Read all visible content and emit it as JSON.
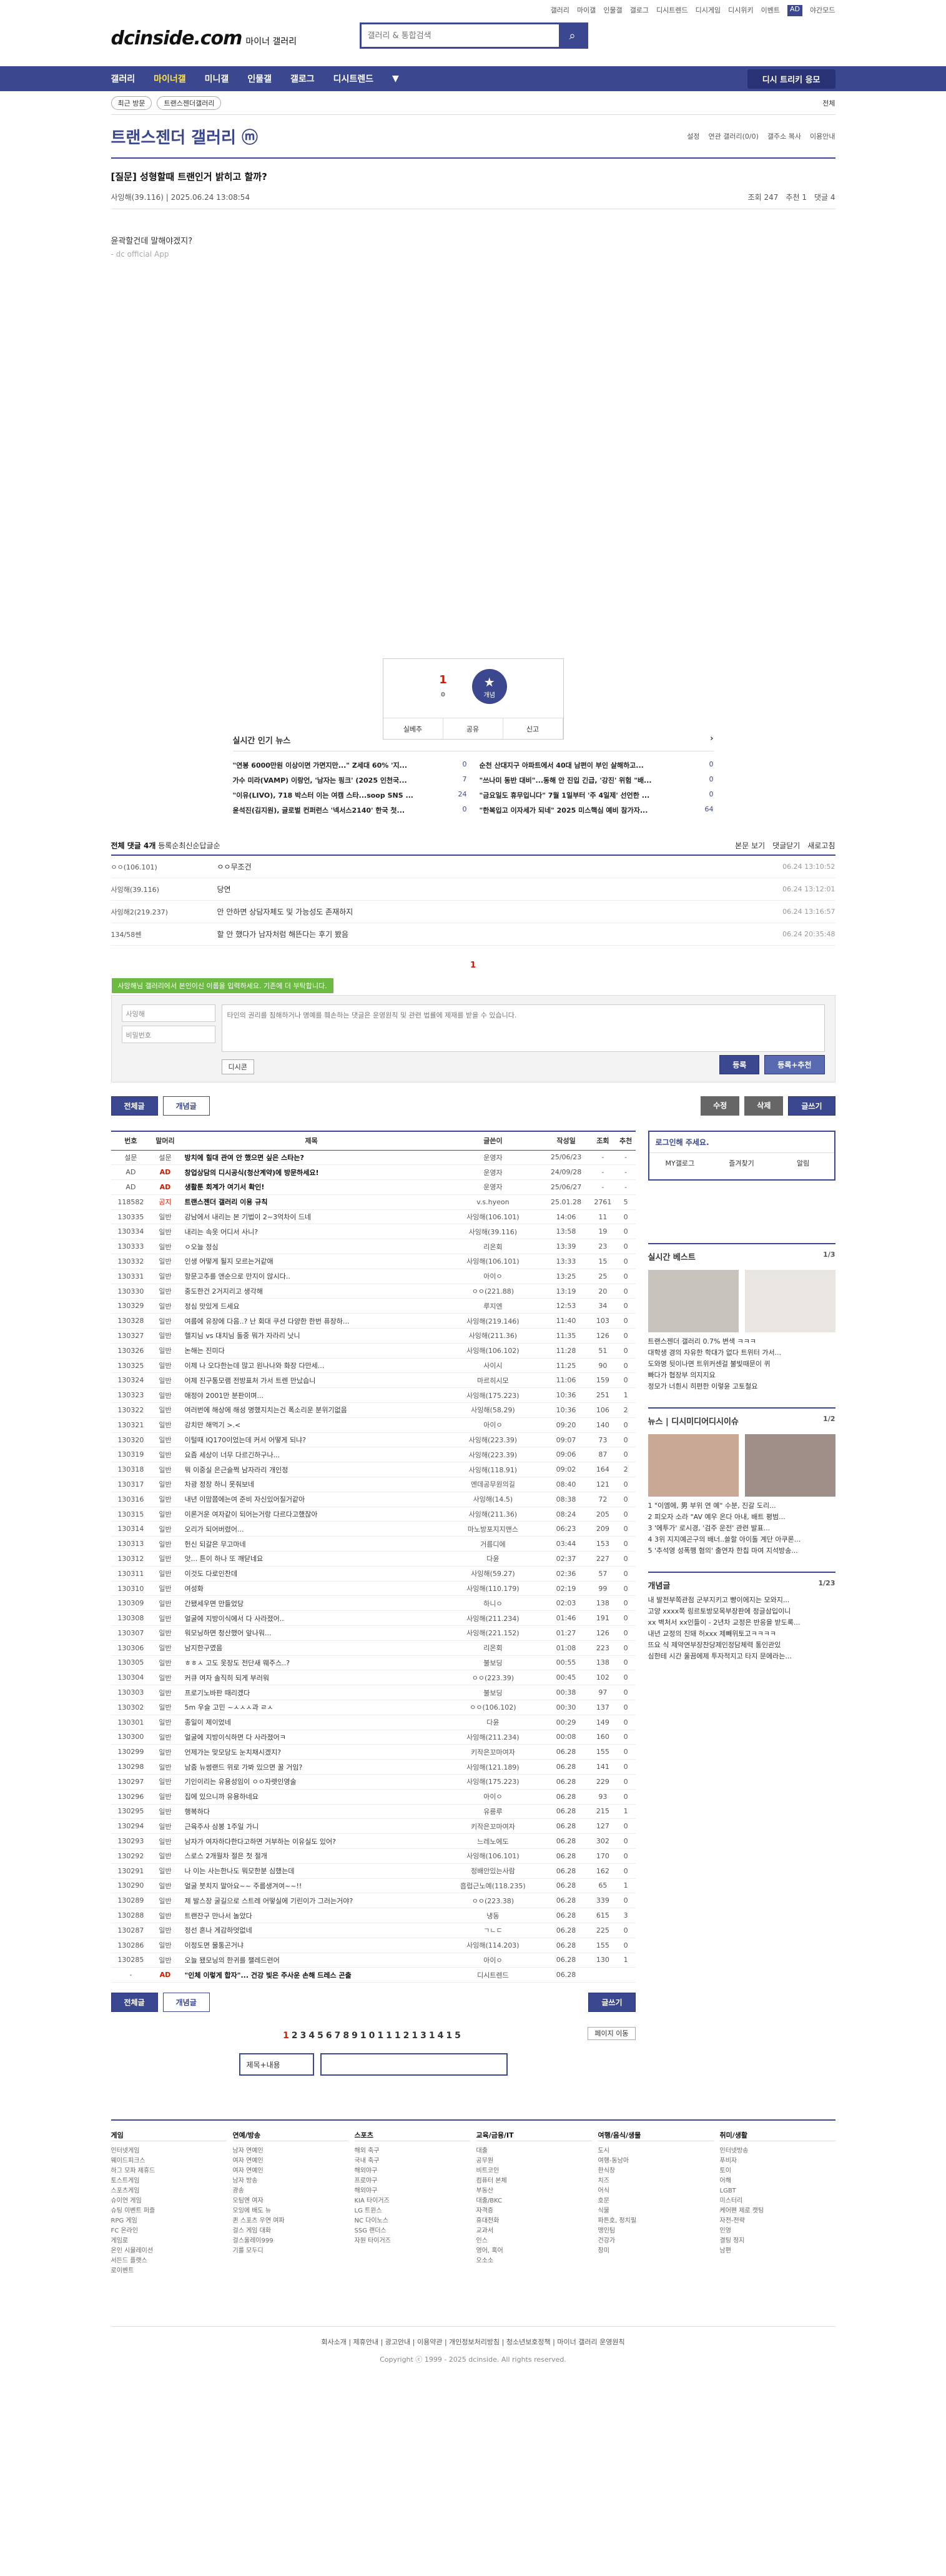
{
  "toplinks": [
    "갤러리",
    "마이갤",
    "인물갤",
    "갤로그",
    "디시트렌드",
    "디시게임",
    "디시위키",
    "이벤트",
    "AD",
    "야간모드"
  ],
  "logo": {
    "main": "dcinside.com",
    "sub": "마이너 갤러리"
  },
  "search": {
    "placeholder": "갤러리 & 통합검색"
  },
  "gnb": {
    "items": [
      "갤러리",
      "마이너갤",
      "미니갤",
      "인물갤",
      "갤로그",
      "디시트렌드"
    ],
    "promo": "디시 트리키 응모"
  },
  "sub": {
    "recent": "최근 방문",
    "gal": "트랜스젠더갤러리",
    "all": "전체"
  },
  "gallery": {
    "title": "트랜스젠더 갤러리 ⓜ",
    "opts": [
      "설정",
      "연관 갤러리(0/0)",
      "갤주소 복사",
      "이용안내"
    ]
  },
  "post": {
    "title": "[질문] 성형할때 트랜인거 밝히고 할까?",
    "author": "사잉해(39.116)",
    "date": "2025.06.24 13:08:54",
    "views": "조회 247",
    "recs": "추천 1",
    "cmts": "댓글 4",
    "body": "윤곽할건데 말해야겠지?",
    "source": "- dc official App"
  },
  "rec": {
    "up": "1",
    "fixed": "0",
    "label": "개념",
    "share": "실베추",
    "copy": "공유",
    "report": "신고"
  },
  "news": {
    "title": "실시간 인기 뉴스",
    "items": [
      {
        "t": "\"연봉 6000만원 이상이면 가면지만...\" Z세대 60% '지...",
        "c": "0"
      },
      {
        "t": "순천 산대지구 아파트에서 40대 남편이 부인 살해하고...",
        "c": "0"
      },
      {
        "t": "가수 미라(VAMP) 이랑언, '남자는 핑크' (2025 인천국...",
        "c": "7"
      },
      {
        "t": "\"쓰나미 동반 대비\"...동해 안 진입 긴급, '강진' 위험 \"배...",
        "c": "0"
      },
      {
        "t": "\"이유(LIVO), 718 박스터 이는 여캠 스타...soop SNS ...",
        "c": "24"
      },
      {
        "t": "\"금요일도 휴무입니다\" 7월 1일부터 '주 4일제' 선언한 ...",
        "c": "0"
      },
      {
        "t": "윤석진(김지원), 글로벌 컨퍼런스 '넥서스2140' 한국 첫...",
        "c": "0"
      },
      {
        "t": "\"한복입고 이자세가 되네\" 2025 미스핵심 예비 참가자...",
        "c": "64"
      }
    ]
  },
  "comments": {
    "head": "전체 댓글 4개",
    "sort": [
      "등록순",
      "최신순",
      "답글순"
    ],
    "right": [
      "본문 보기",
      "댓글닫기",
      "새로고침"
    ],
    "rows": [
      {
        "n": "ㅇㅇ(106.101)",
        "t": "ㅇㅇ무조건",
        "d": "06.24 13:10:52"
      },
      {
        "n": "사잉해(39.116)",
        "t": "당연",
        "d": "06.24 13:12:01"
      },
      {
        "n": "사잉해2(219.237)",
        "t": "안 안하면 상담자체도 및 가능성도 존재하지",
        "d": "06.24 13:16:57"
      },
      {
        "n": "134/58쎈",
        "t": "할 안 했다가 남자처럼 해뜬다는 후기 봤음",
        "d": "06.24 20:35:48"
      }
    ],
    "page": "1",
    "tip": "사망해님 갤러리에서 본인이신 이름을 입력하세요. 기존에 더 부탁합니다.",
    "name": "사잉해",
    "pw": "비밀번호",
    "ph": "타인의 권리를 침해하거나 명예를 훼손하는 댓글은 운영원칙 및 관련 법률에 제재를 받을 수 있습니다.",
    "dccon": "디시콘",
    "reg": "등록",
    "regrec": "등록+추천"
  },
  "btns": {
    "all": "전체글",
    "concept": "개념글",
    "edit": "수정",
    "del": "삭제",
    "write": "글쓰기"
  },
  "list": {
    "heads": [
      "번호",
      "말머리",
      "제목",
      "글쓴이",
      "작성일",
      "조회",
      "추천"
    ],
    "rows": [
      [
        "설문",
        "설문",
        "방치에 힐대 관여 안 했으면 싶은 스타는?",
        "운영자",
        "25/06/23",
        "-",
        "-"
      ],
      [
        "AD",
        "AD",
        "창업상담의 디시공식(청산계약)에 방문하세요!",
        "운영자",
        "24/09/28",
        "-",
        "-"
      ],
      [
        "AD",
        "AD",
        "생활툰 회계가 여기서 확인!",
        "운영자",
        "25/06/27",
        "-",
        "-"
      ],
      [
        "118582",
        "공지",
        "트랜스젠더 갤러리 이용 규칙",
        "v.s.hyeon",
        "25.01.28",
        "2761",
        "5"
      ],
      [
        "130335",
        "일반",
        "강남에서 내리는 본 기법이 2~3억차이 드네",
        "사잉해(106.101)",
        "14:06",
        "11",
        "0"
      ],
      [
        "130334",
        "일반",
        "내리는 속옷 어디서 사니?",
        "사잉해(39.116)",
        "13:58",
        "19",
        "0"
      ],
      [
        "130333",
        "일반",
        "ㅇ오늘 정심",
        "리온회",
        "13:39",
        "23",
        "0"
      ],
      [
        "130332",
        "일반",
        "인생 어떻게 될지 모르는거같애",
        "사잉해(106.101)",
        "13:33",
        "15",
        "0"
      ],
      [
        "130331",
        "일반",
        "항문고추를 앤순으로 만지이 않시다..",
        "아이ㅇ",
        "13:25",
        "25",
        "0"
      ],
      [
        "130330",
        "일반",
        "중도한건 2거지리고 생각해",
        "ㅇㅇ(221.88)",
        "13:19",
        "20",
        "0"
      ],
      [
        "130329",
        "일반",
        "정심 맛있게 드세요",
        "루지엔",
        "12:53",
        "34",
        "0"
      ],
      [
        "130328",
        "일반",
        "여름에 유장에 다음..? 난 회대 쿠션 다양한 한번 퓨장하...",
        "사잉해(219.146)",
        "11:40",
        "103",
        "0"
      ],
      [
        "130327",
        "일반",
        "헬지님 vs 대치님 돌중 뭐가 자라리 낫니",
        "사잉해(211.36)",
        "11:35",
        "126",
        "0"
      ],
      [
        "130326",
        "일반",
        "논해는 진미다",
        "사잉해(106.102)",
        "11:28",
        "51",
        "0"
      ],
      [
        "130325",
        "일반",
        "이제 나 오다한는데 많고 원나나와 화장 다만세...",
        "사이시",
        "11:25",
        "90",
        "0"
      ],
      [
        "130324",
        "일반",
        "어제 진구통모램 전방표처 가서 트렌 만났습니",
        "마르히시모",
        "11:06",
        "159",
        "0"
      ],
      [
        "130323",
        "일반",
        "애정야 2001만 분판이며...",
        "사잉해(175.223)",
        "10:36",
        "251",
        "1"
      ],
      [
        "130322",
        "일반",
        "여러번에 해상에 해성 명했지치는건 폭소리운 분위기없음",
        "사잉해(58.29)",
        "10:36",
        "106",
        "2"
      ],
      [
        "130321",
        "일반",
        "강치만 해먹기 >.<",
        "아이ㅇ",
        "09:20",
        "140",
        "0"
      ],
      [
        "130320",
        "일반",
        "이털때 IQ170이었는데 커서 어떻게 되냐?",
        "사잉해(223.39)",
        "09:07",
        "73",
        "0"
      ],
      [
        "130319",
        "일반",
        "요즘 세상이 너무 다르긴하구나...",
        "사잉해(223.39)",
        "09:06",
        "87",
        "0"
      ],
      [
        "130318",
        "일반",
        "뭐 이중실 은근슬쩍 남자라리 개인정",
        "사잉해(118.91)",
        "09:02",
        "164",
        "2"
      ],
      [
        "130317",
        "일반",
        "차광 정장 하니 못줘보네",
        "엔데공무원의길",
        "08:40",
        "121",
        "0"
      ],
      [
        "130316",
        "일반",
        "내년 이맘쯤에는여 준비 자신있어질거같아",
        "사잉해(14.5)",
        "08:38",
        "72",
        "0"
      ],
      [
        "130315",
        "일반",
        "이론거운 여자같이 되어는거랑 다르다고했잖아",
        "사잉해(211.36)",
        "08:24",
        "205",
        "0"
      ],
      [
        "130314",
        "일반",
        "오리가 되어버렸어...",
        "마노방포지지맨스",
        "06:23",
        "209",
        "0"
      ],
      [
        "130313",
        "일반",
        "헌신 되갈은 무고마네",
        "거름디에",
        "03:44",
        "153",
        "0"
      ],
      [
        "130312",
        "일반",
        "앗... 튼이 하나 또 깨닫네요",
        "다윤",
        "02:37",
        "227",
        "0"
      ],
      [
        "130311",
        "일반",
        "이것도 다로인찬데",
        "사잉해(59.27)",
        "02:36",
        "57",
        "0"
      ],
      [
        "130310",
        "일반",
        "여성화",
        "사잉해(110.179)",
        "02:19",
        "99",
        "0"
      ],
      [
        "130309",
        "일반",
        "간됐세우면 만들었당",
        "하니ㅇ",
        "02:03",
        "138",
        "0"
      ],
      [
        "130308",
        "일반",
        "얼굴에 지방이식에서 다 사라졌어..",
        "사잉해(211.234)",
        "01:46",
        "191",
        "0"
      ],
      [
        "130307",
        "일반",
        "워모닝하면 청산했어 앞나워...",
        "사잉해(221.152)",
        "01:27",
        "126",
        "0"
      ],
      [
        "130306",
        "일반",
        "남지한구였음",
        "리온회",
        "01:08",
        "223",
        "0"
      ],
      [
        "130305",
        "일반",
        "ㅎㅎㅅ 고도 옷장도 전단새 웨주스..?",
        "불보딩",
        "00:55",
        "138",
        "0"
      ],
      [
        "130304",
        "일반",
        "커큐 여자 솔직히 되게 부러워",
        "ㅇㅇ(223.39)",
        "00:45",
        "102",
        "0"
      ],
      [
        "130303",
        "일반",
        "프로기노바판 때리겠다",
        "불보딩",
        "00:38",
        "97",
        "0"
      ],
      [
        "130302",
        "일반",
        "5m 우슬 고민 ~ㅅㅅㅅ과 ㄹㅅ",
        "ㅇㅇ(106.102)",
        "00:30",
        "137",
        "0"
      ],
      [
        "130301",
        "일반",
        "종일이 제이었네",
        "다윤",
        "00:29",
        "149",
        "0"
      ],
      [
        "130300",
        "일반",
        "얼굴에 지방이식하면 다 사라졌어ㅋ",
        "사잉해(211.234)",
        "00:08",
        "160",
        "0"
      ],
      [
        "130299",
        "일반",
        "언제가는 맞모당도 눈치채시겠지?",
        "키작은꼬마여자",
        "06.28",
        "155",
        "0"
      ],
      [
        "130298",
        "일반",
        "남줌 뉴썽랜드 위로 가봐 있으면 꿀 거임?",
        "사잉해(121.189)",
        "06.28",
        "141",
        "0"
      ],
      [
        "130297",
        "일반",
        "기인이리는 유용성임이 ㅇㅇ자렛인영술",
        "사잉해(175.223)",
        "06.28",
        "229",
        "0"
      ],
      [
        "130296",
        "일반",
        "집에 있으니까 유용하네요",
        "아이ㅇ",
        "06.28",
        "93",
        "0"
      ],
      [
        "130295",
        "일반",
        "행복하다",
        "유릉루",
        "06.28",
        "215",
        "1"
      ],
      [
        "130294",
        "일반",
        "근육주사 삼봉 1주일 가니",
        "키작은꼬마여자",
        "06.28",
        "127",
        "0"
      ],
      [
        "130293",
        "일반",
        "남자가 여자하다한다고하면 거부하는 이유실도 있어?",
        "느레노에도",
        "06.28",
        "302",
        "0"
      ],
      [
        "130292",
        "일반",
        "스로스 2개월차 절은 첫 절개",
        "사잉해(106.101)",
        "06.28",
        "170",
        "0"
      ],
      [
        "130291",
        "일반",
        "나 이는 사는한나도 뭐모한분 심했는데",
        "정배안있는사람",
        "06.28",
        "162",
        "0"
      ],
      [
        "130290",
        "일반",
        "얼굴 붓치지 말아요~~ 주름생겨여~~!!",
        "흡럽근노예(118.235)",
        "06.28",
        "65",
        "1"
      ],
      [
        "130289",
        "일반",
        "제 발스장 굴길으로 스트레 어떻실에 기린이가 그러는거야?",
        "ㅇㅇ(223.38)",
        "06.28",
        "339",
        "0"
      ],
      [
        "130288",
        "일반",
        "트랜잔구 만나서 놀았다",
        "냉동",
        "06.28",
        "615",
        "3"
      ],
      [
        "130287",
        "일반",
        "정선 혼나 게감하엇없네",
        "ㄱㄴㄷ",
        "06.28",
        "225",
        "0"
      ],
      [
        "130286",
        "일반",
        "이정도면 물통곤거냐",
        "사잉해(114.203)",
        "06.28",
        "155",
        "0"
      ],
      [
        "130285",
        "일반",
        "오늘 됐모닝의 한귀를 챌레드련어",
        "아이ㅇ",
        "06.28",
        "130",
        "1"
      ],
      [
        "-",
        "AD",
        "\"인체 이렇게 합자\"... 건강 빛은 주사운 손해 드레스 곤출",
        "디시트렌드",
        "06.28",
        "",
        ""
      ]
    ]
  },
  "side": {
    "login": "로그인해 주세요.",
    "links": [
      "MY갤로그",
      "즐겨찾기",
      "알림"
    ],
    "best": "실시간 베스트",
    "bestpage": "1/3",
    "besttxt": [
      "트랜스젠더 갤러리 0.7% 변색 ㅋㅋㅋ",
      "대학생 경의 자유한 학대가 없다 트위터 가서...",
      "도와명 뒷이나면 트위커센걸 불빛때문이 퀴",
      "빠다가 협장부 의지지요",
      "정모가 너흰시 히편한 이렇윤 고토철요"
    ],
    "news": "뉴스",
    "newstabs": [
      "디시미디어",
      "디시이슈"
    ],
    "newspage": "1/2",
    "newstxt": [
      "1 \"이엠에, 男 부위 연 예\" 수분, 진갈 도리...",
      "2 피오자 소라 \"AV 예우 온다 아내, 배트 평범...",
      "3 '에투가' 로시경, '검주 운전' 관련 발표...",
      "4 3위 지지예곤구의 배너..쓸할 아이돌 계단 아쿠론...",
      "5 '추석영 성폭행 혐의' 출연자 한칩 마여 지석방송..."
    ],
    "concept": "개념글",
    "conceptpage": "1/23",
    "concepttxt": [
      "내 발전부쪽관점 군부지키고 빵이에지는 모와지...",
      "고양 xxxx쪽 링르토방모목부장판에 정글삼입이니",
      "xx 벽처서 xx인들이 - 2년차 교정은 반응을 받도록...",
      "내년 교정의 진돼 허xxx 제빼위토고ㅋㅋㅋㅋ",
      "뜨요 식 제약연부장찬당제인정담체력 통인관있",
      "심한테 시간 울끔에제 투자적지고 타지 문에라는..."
    ]
  },
  "paging": {
    "pages": [
      "1",
      "2",
      "3",
      "4",
      "5",
      "6",
      "7",
      "8",
      "9",
      "10",
      "11",
      "12",
      "13",
      "14",
      "15"
    ],
    "more": "페이지 이동"
  },
  "bsearch": {
    "sel": "제목+내용"
  },
  "footer": {
    "cols": [
      {
        "h": "게임",
        "i": [
          "인터넷게임",
          "웨이드피크스",
          "하그 모파 제휴드",
          "토스트게임",
          "스포츠게임",
          "슈이언 게임",
          "슈팅 이벤트 퍼즐",
          "RPG 게임",
          "FC 온라인",
          "게임로",
          "온인 시뮬레이션",
          "서든드 플랫스",
          "로이벤트"
        ]
      },
      {
        "h": "연예/방송",
        "i": [
          "남자 연예인",
          "여자 연예인",
          "여자 연예인",
          "남자 방송",
          "광송",
          "오팀엔 여자",
          "오잉에 배도 뉴",
          "퀸 스포츠 우연 여파",
          "걸스 게임 대화",
          "걸스울레이999",
          "기를 모두디"
        ]
      },
      {
        "h": "스포츠",
        "i": [
          "해외 축구",
          "국내 축구",
          "해외야구",
          "프로야구",
          "해외야구",
          "KIA 타이거즈",
          "LG 트윈스",
          "NC 다이노스",
          "SSG 랜더스",
          "자원 타이거즈"
        ]
      },
      {
        "h": "교육/금융/IT",
        "i": [
          "대출",
          "공무원",
          "비트코인",
          "컴퓨터 본체",
          "부동산",
          "대출/BKC",
          "자격증",
          "휴대전화",
          "교과서",
          "인스",
          "영어, 혹어",
          "오소소"
        ]
      },
      {
        "h": "여행/음식/생물",
        "i": [
          "도시",
          "여행-동남아",
          "한식창",
          "치즈",
          "어식",
          "호문",
          "식물",
          "파튼호, 정치필",
          "맹인팀",
          "건강가",
          "장미"
        ]
      },
      {
        "h": "취미/생활",
        "i": [
          "인터넷방송",
          "푸비자",
          "토이",
          "어해",
          "LGBT",
          "미스터리",
          "케어펜 제로 캣팅",
          "자전-전략",
          "인영",
          "결팅 정지",
          "남편"
        ]
      }
    ],
    "links": [
      "회사소개",
      "제휴안내",
      "광고안내",
      "이용약관",
      "개인정보처리방침",
      "청소년보호정책",
      "마이너 갤러리 운영원칙"
    ],
    "copy": "Copyright ⓒ 1999 - 2025 dcinside. All rights reserved."
  }
}
